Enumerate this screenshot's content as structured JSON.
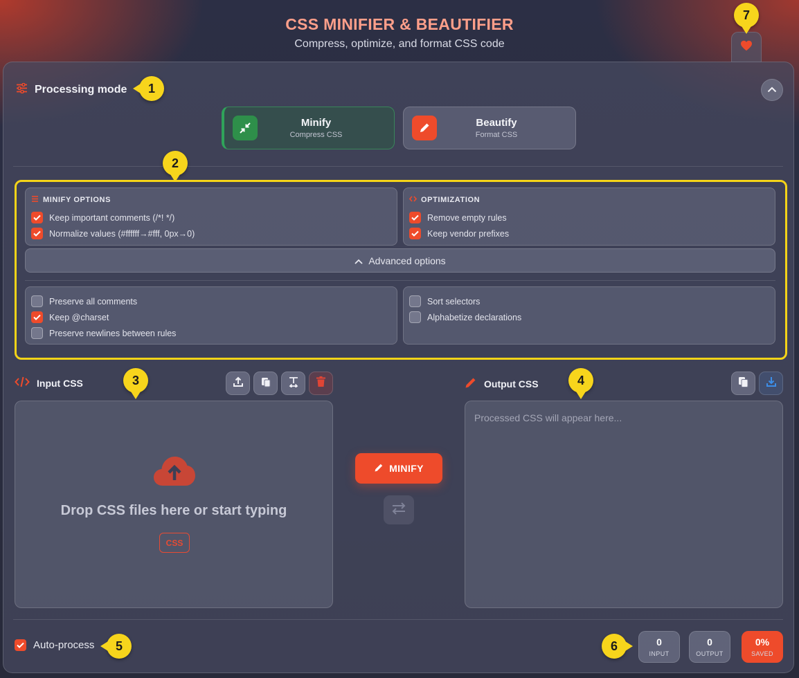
{
  "header": {
    "title": "CSS MINIFIER & BEAUTIFIER",
    "subtitle": "Compress, optimize, and format CSS code"
  },
  "processing_mode": {
    "title": "Processing mode",
    "modes": [
      {
        "name": "Minify",
        "desc": "Compress CSS",
        "active": true
      },
      {
        "name": "Beautify",
        "desc": "Format CSS",
        "active": false
      }
    ]
  },
  "options": {
    "minify_header": "MINIFY OPTIONS",
    "minify_items": [
      {
        "label": "Keep important comments (/*! */)",
        "checked": true
      },
      {
        "label": "Normalize values (#ffffff→#fff, 0px→0)",
        "checked": true
      }
    ],
    "optimization_header": "OPTIMIZATION",
    "optimization_items": [
      {
        "label": "Remove empty rules",
        "checked": true
      },
      {
        "label": "Keep vendor prefixes",
        "checked": true
      }
    ],
    "advanced_label": "Advanced options",
    "advanced_left": [
      {
        "label": "Preserve all comments",
        "checked": false
      },
      {
        "label": "Keep @charset",
        "checked": true
      },
      {
        "label": "Preserve newlines between rules",
        "checked": false
      }
    ],
    "advanced_right": [
      {
        "label": "Sort selectors",
        "checked": false
      },
      {
        "label": "Alphabetize declarations",
        "checked": false
      }
    ]
  },
  "input": {
    "title": "Input CSS",
    "drop_text": "Drop CSS files here or start typing",
    "tag": "CSS"
  },
  "output": {
    "title": "Output CSS",
    "placeholder": "Processed CSS will appear here..."
  },
  "action": {
    "label": "MINIFY"
  },
  "auto_process": {
    "label": "Auto-process",
    "checked": true
  },
  "stats": [
    {
      "value": "0",
      "label": "INPUT"
    },
    {
      "value": "0",
      "label": "OUTPUT"
    },
    {
      "value": "0%",
      "label": "SAVED"
    }
  ],
  "badges": [
    "1",
    "2",
    "3",
    "4",
    "5",
    "6",
    "7"
  ],
  "colors": {
    "accent": "#ee4b2b",
    "success": "#2fa35a",
    "badge": "#f7d51c"
  }
}
